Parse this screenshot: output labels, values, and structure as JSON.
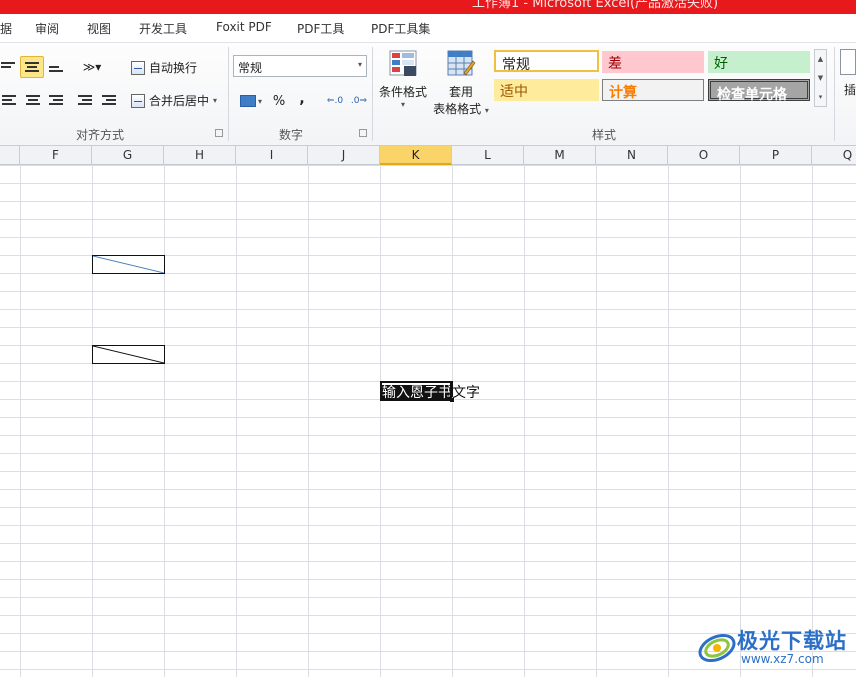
{
  "window": {
    "title": "工作簿1 - Microsoft Excel(产品激活失败)"
  },
  "menu": [
    "据",
    "审阅",
    "视图",
    "开发工具",
    "Foxit PDF",
    "PDF工具",
    "PDF工具集"
  ],
  "ribbon": {
    "alignment": {
      "group_label": "对齐方式",
      "wrap_text": "自动换行",
      "merge_center": "合并后居中"
    },
    "number": {
      "group_label": "数字",
      "format_value": "常规",
      "percent": "%",
      "comma": ","
    },
    "styles": {
      "group_label": "样式",
      "conditional_format": "条件格式",
      "table_format_line1": "套用",
      "table_format_line2": "表格格式",
      "cells": [
        {
          "label": "常规",
          "fg": "#222222",
          "bg": "#ffffff"
        },
        {
          "label": "差",
          "fg": "#9c0006",
          "bg": "#ffc7ce"
        },
        {
          "label": "好",
          "fg": "#006100",
          "bg": "#c6efce"
        },
        {
          "label": "适中",
          "fg": "#9c5700",
          "bg": "#ffeb9c"
        },
        {
          "label": "计算",
          "fg": "#fa7d00",
          "bg": "#f2f2f2"
        },
        {
          "label": "检查单元格",
          "fg": "#ffffff",
          "bg": "#a5a5a5"
        }
      ]
    },
    "cells_group": {
      "insert_partial": "插"
    }
  },
  "columns": [
    "F",
    "G",
    "H",
    "I",
    "J",
    "K",
    "L",
    "M",
    "N",
    "O",
    "P",
    "Q"
  ],
  "selected_column": "K",
  "cell": {
    "text_selected": "输入恩子书",
    "text_rest": "文字"
  },
  "watermark": {
    "title": "极光下载站",
    "url": "www.xz7.com"
  }
}
